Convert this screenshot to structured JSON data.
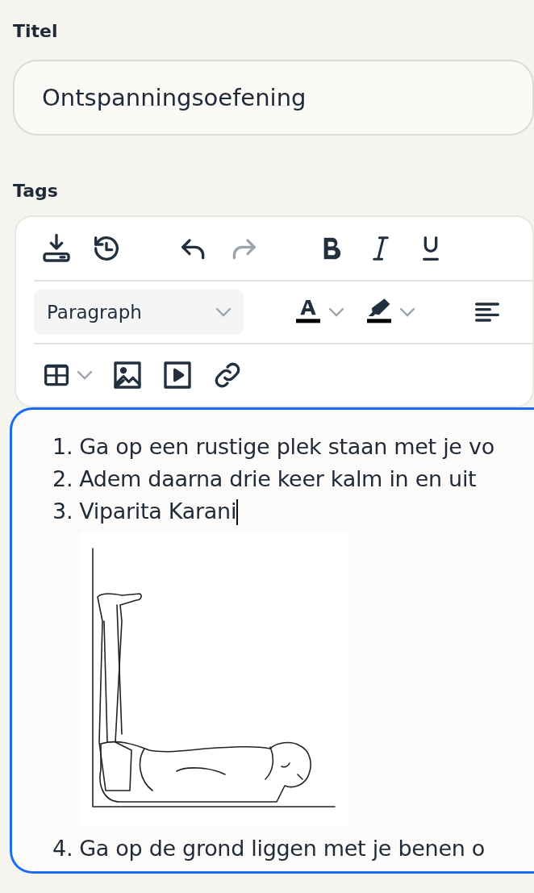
{
  "title_field": {
    "label": "Titel",
    "value": "Ontspanningsoefening"
  },
  "tags_label": "Tags",
  "toolbar": {
    "rows": [
      [
        {
          "kind": "save",
          "disabled": false
        },
        {
          "kind": "history",
          "disabled": false
        },
        {
          "kind": "gap"
        },
        {
          "kind": "undo",
          "disabled": false
        },
        {
          "kind": "redo",
          "disabled": true
        },
        {
          "kind": "gap"
        },
        {
          "kind": "bold",
          "disabled": false
        },
        {
          "kind": "italic",
          "disabled": false
        },
        {
          "kind": "underline",
          "disabled": false
        }
      ],
      [
        {
          "kind": "select",
          "value": "Paragraph"
        },
        {
          "kind": "gap"
        },
        {
          "kind": "text-color",
          "disabled": false,
          "dropdown": true
        },
        {
          "kind": "highlight",
          "disabled": false,
          "dropdown": true
        },
        {
          "kind": "gap"
        },
        {
          "kind": "align-left",
          "disabled": false
        }
      ],
      [
        {
          "kind": "table",
          "disabled": false,
          "dropdown": true
        },
        {
          "kind": "image",
          "disabled": false
        },
        {
          "kind": "media",
          "disabled": false
        },
        {
          "kind": "link",
          "disabled": false
        }
      ]
    ]
  },
  "editor": {
    "focused": true,
    "blocks": [
      {
        "kind": "list_item",
        "number": "1.",
        "text": "Ga op een rustige plek staan met je vo",
        "caret": false
      },
      {
        "kind": "list_item",
        "number": "2.",
        "text": "Adem daarna drie keer kalm in en uit",
        "caret": false
      },
      {
        "kind": "list_item",
        "number": "3.",
        "text": "Viparita Karani",
        "caret": true
      },
      {
        "kind": "picture"
      },
      {
        "kind": "list_item",
        "number": "4.",
        "text": "Ga op de grond liggen met je benen o",
        "caret": false
      }
    ]
  }
}
